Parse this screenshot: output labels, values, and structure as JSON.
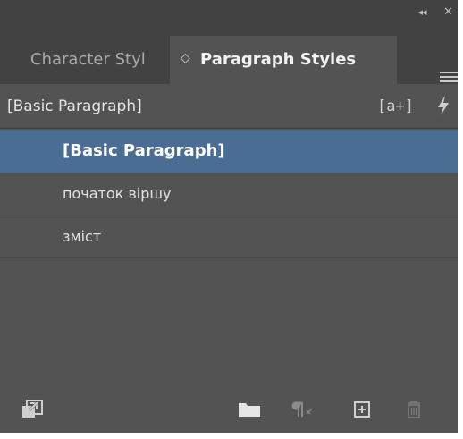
{
  "panel": {
    "collapse_glyph": "◂◂",
    "close_glyph": "✕",
    "tabs": [
      {
        "label": "Character Styl",
        "active": false
      },
      {
        "label": "Paragraph Styles",
        "active": true,
        "icon": "updown-arrows-icon"
      }
    ],
    "tab_updown_glyph": "◇",
    "menu_icon": "hamburger-menu-icon"
  },
  "header": {
    "current_style": "[Basic Paragraph]",
    "create_from_selection": "[a+]",
    "quick_apply_icon": "lightning-icon"
  },
  "styles": [
    {
      "label": "[Basic Paragraph]",
      "selected": true
    },
    {
      "label": "початок віршу",
      "selected": false
    },
    {
      "label": "зміст",
      "selected": false
    }
  ],
  "footer": {
    "icons": [
      "load-styles-icon",
      "folder-icon",
      "clear-overrides-icon",
      "new-style-icon",
      "trash-icon"
    ]
  },
  "colors": {
    "panel_bg": "#535353",
    "tabbar_bg": "#424242",
    "selection": "#4a6e93",
    "text": "#e2e2e2"
  }
}
